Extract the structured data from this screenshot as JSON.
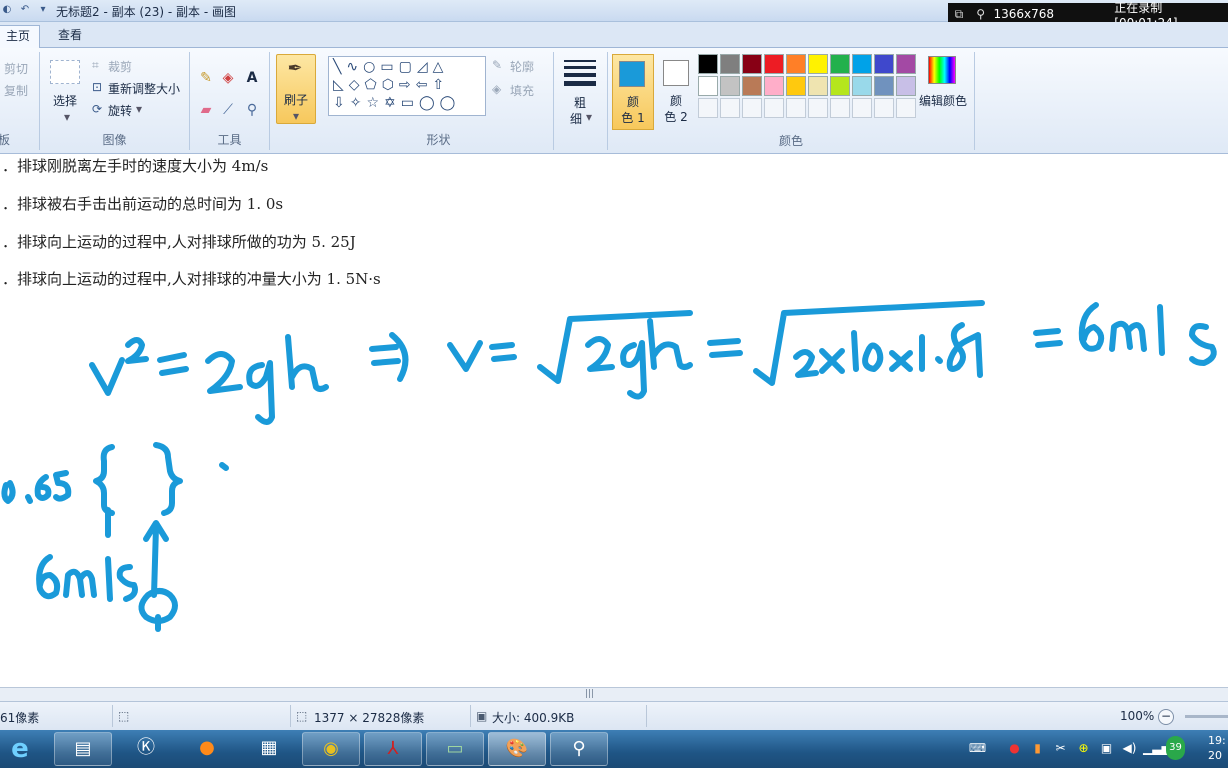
{
  "window": {
    "title": "无标题2 - 副本 (23) - 副本 - 画图",
    "recorder_resolution": "1366x768",
    "recorder_status": "正在录制 [00:01:24]"
  },
  "tabs": {
    "home": "主页",
    "view": "查看"
  },
  "ribbon": {
    "clipboard": {
      "cut": "剪切",
      "copy": "复制",
      "label": "板"
    },
    "image": {
      "select": "选择",
      "crop": "裁剪",
      "resize": "重新调整大小",
      "rotate": "旋转",
      "label": "图像"
    },
    "tools": {
      "label": "工具"
    },
    "brushes": {
      "label": "刷子"
    },
    "shapes": {
      "outline": "轮廓",
      "fill": "填充",
      "label": "形状"
    },
    "size": {
      "line1": "粗",
      "line2": "细"
    },
    "colors": {
      "color1_line1": "颜",
      "color1_line2": "色 1",
      "color2_line1": "颜",
      "color2_line2": "色 2",
      "edit": "编辑颜色",
      "label": "颜色",
      "color1_value": "#1a9ad9",
      "color2_value": "#ffffff",
      "palette_row1": [
        "#000000",
        "#7f7f7f",
        "#880015",
        "#ed1c24",
        "#ff7f27",
        "#fff200",
        "#22b14c",
        "#00a2e8",
        "#3f48cc",
        "#a349a4"
      ],
      "palette_row2": [
        "#ffffff",
        "#c3c3c3",
        "#b97a57",
        "#ffaec9",
        "#ffc90e",
        "#efe4b0",
        "#b5e61d",
        "#99d9ea",
        "#7092be",
        "#c8bfe7"
      ]
    }
  },
  "canvas": {
    "question_lines": [
      "．排球刚脱离左手时的速度大小为 4m/s",
      "．排球被右手击出前运动的总时间为 1. 0s",
      "．排球向上运动的过程中,人对排球所做的功为 5. 25J",
      "．排球向上运动的过程中,人对排球的冲量大小为 1. 5N·s"
    ],
    "ink_color": "#1a9ad9"
  },
  "statusbar": {
    "cursor_pos": "61像素",
    "image_size": "1377 × 27828像素",
    "file_size": "大小: 400.9KB",
    "zoom": "100%"
  },
  "taskbar": {
    "apps": [
      "ie-icon",
      "explorer-icon",
      "k-app-icon",
      "firefox-icon",
      "calculator-icon",
      "chrome-icon",
      "pdf-icon",
      "photo-viewer-icon",
      "paint-icon",
      "screen-recorder-icon"
    ],
    "tray_badge": "39",
    "clock_time": "19:",
    "clock_date": "20"
  }
}
